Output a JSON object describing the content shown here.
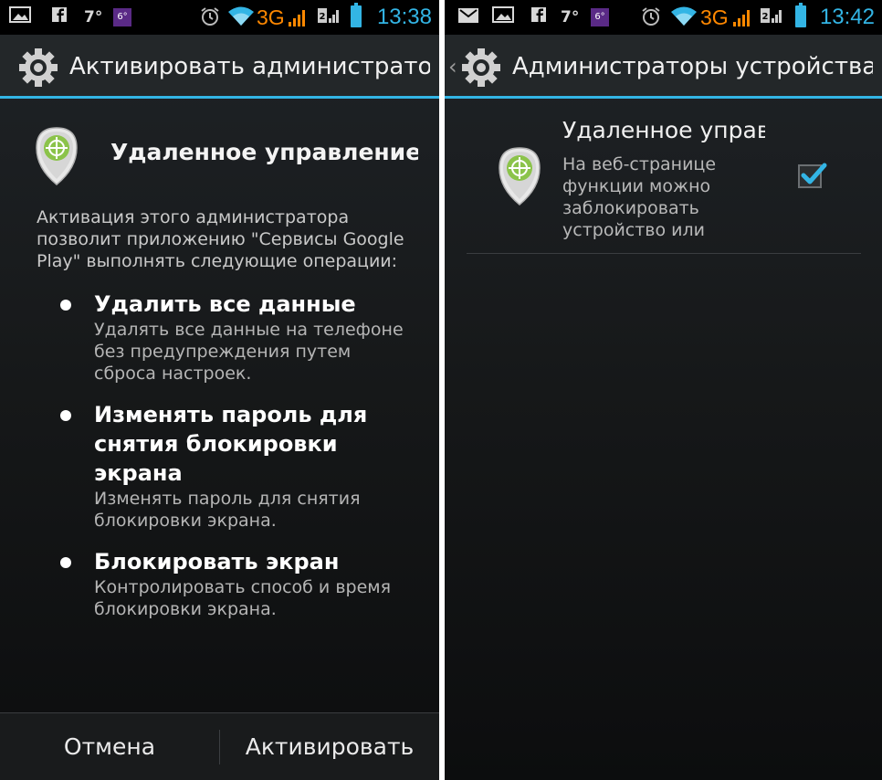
{
  "colors": {
    "accent": "#33b5e5",
    "network": "#ff8800",
    "background": "#1a1c1e"
  },
  "left": {
    "status": {
      "temperature": "7°",
      "badge": "6°",
      "network": "3G",
      "time": "13:38"
    },
    "actionbar": {
      "title": "Активировать администрато...",
      "icon": "settings-gear-icon"
    },
    "dialog": {
      "icon": "device-manager-icon",
      "title": "Удаленное управление Android",
      "description": "Активация этого администратора позволит приложению \"Сервисы Google Play\" выполнять следующие операции:",
      "permissions": [
        {
          "title": "Удалить все данные",
          "description": "Удалять все данные на телефоне без предупреждения путем сброса настроек."
        },
        {
          "title": "Изменять пароль для снятия блокировки экрана",
          "description": "Изменять пароль для снятия блокировки экрана."
        },
        {
          "title": "Блокировать экран",
          "description": "Контролировать способ и время блокировки экрана."
        }
      ],
      "buttons": {
        "cancel": "Отмена",
        "activate": "Активировать"
      }
    }
  },
  "right": {
    "status": {
      "temperature": "7°",
      "badge": "6°",
      "network": "3G",
      "time": "13:42"
    },
    "actionbar": {
      "title": "Администраторы устройства",
      "icon": "settings-gear-icon"
    },
    "admins": [
      {
        "title": "Удаленное управление Android",
        "description": "На веб-странице функции можно заблокировать устройство или",
        "checked": true,
        "icon": "device-manager-icon"
      }
    ]
  }
}
